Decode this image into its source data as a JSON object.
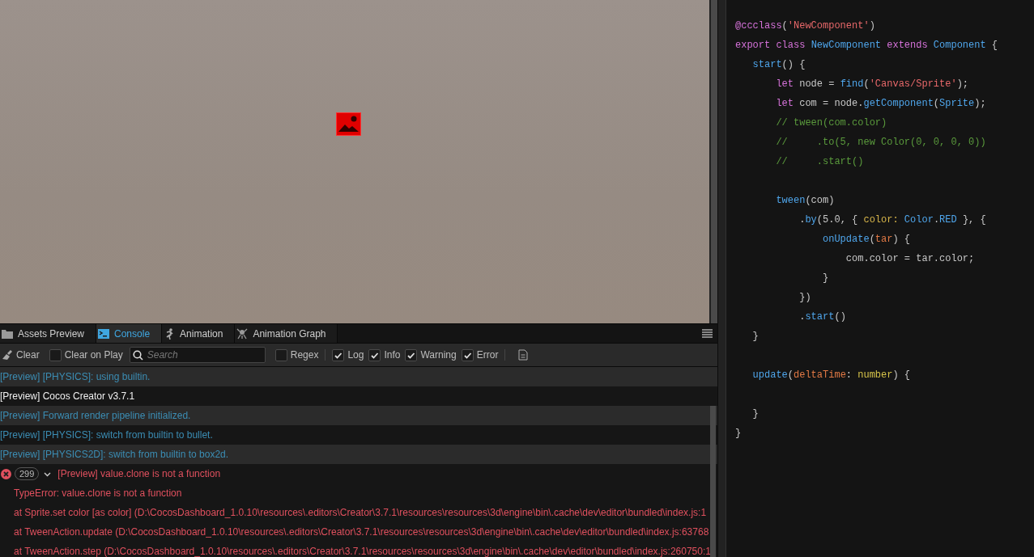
{
  "tabs": [
    {
      "label": "Assets Preview",
      "kind": "folder",
      "selected": false
    },
    {
      "label": "Console",
      "kind": "terminal",
      "selected": true
    },
    {
      "label": "Animation",
      "kind": "runner",
      "selected": false
    },
    {
      "label": "Animation Graph",
      "kind": "graph",
      "selected": false
    }
  ],
  "toolbar": {
    "clear": "Clear",
    "clear_on_play": {
      "label": "Clear on Play",
      "checked": false
    },
    "search": {
      "placeholder": "Search"
    },
    "regex": {
      "label": "Regex",
      "checked": false
    },
    "filters": [
      {
        "label": "Log",
        "checked": true
      },
      {
        "label": "Info",
        "checked": true
      },
      {
        "label": "Warning",
        "checked": true
      },
      {
        "label": "Error",
        "checked": true
      }
    ]
  },
  "log": [
    {
      "kind": "info",
      "text": "[Preview] [PHYSICS]: using builtin."
    },
    {
      "kind": "log",
      "text": "[Preview] Cocos Creator v3.7.1"
    },
    {
      "kind": "info",
      "text": "[Preview] Forward render pipeline initialized."
    },
    {
      "kind": "info",
      "text": "[Preview] [PHYSICS]: switch from builtin to bullet."
    },
    {
      "kind": "info",
      "text": "[Preview] [PHYSICS2D]: switch from builtin to box2d."
    },
    {
      "kind": "error",
      "count": "299",
      "expanded": true,
      "text": "[Preview] value.clone is not a function",
      "stack": [
        "TypeError: value.clone is not a function",
        "at Sprite.set color [as color] (D:\\CocosDashboard_1.0.10\\resources\\.editors\\Creator\\3.7.1\\resources\\resources\\3d\\engine\\bin\\.cache\\dev\\editor\\bundled\\index.js:1",
        "at TweenAction.update (D:\\CocosDashboard_1.0.10\\resources\\.editors\\Creator\\3.7.1\\resources\\resources\\3d\\engine\\bin\\.cache\\dev\\editor\\bundled\\index.js:63768",
        "at TweenAction.step (D:\\CocosDashboard_1.0.10\\resources\\.editors\\Creator\\3.7.1\\resources\\resources\\3d\\engine\\bin\\.cache\\dev\\editor\\bundled\\index.js:260750:1"
      ]
    }
  ],
  "code": [
    {
      "kind": "code",
      "tokens": [
        {
          "kind": "keyword",
          "text": "@ccclass"
        },
        {
          "kind": "plain",
          "text": "("
        },
        {
          "kind": "string",
          "text": "'NewComponent'"
        },
        {
          "kind": "plain",
          "text": ")"
        }
      ]
    },
    {
      "kind": "code",
      "tokens": [
        {
          "kind": "keyword",
          "text": "export class "
        },
        {
          "kind": "name",
          "text": "NewComponent"
        },
        {
          "kind": "keyword",
          "text": " extends "
        },
        {
          "kind": "name",
          "text": "Component"
        },
        {
          "kind": "plain",
          "text": " {"
        }
      ]
    },
    {
      "kind": "code",
      "tokens": [
        {
          "kind": "name",
          "text": "   start"
        },
        {
          "kind": "plain",
          "text": "() {"
        }
      ]
    },
    {
      "kind": "code",
      "tokens": [
        {
          "kind": "keyword",
          "text": "       let"
        },
        {
          "kind": "plain",
          "text": " node = "
        },
        {
          "kind": "name",
          "text": "find"
        },
        {
          "kind": "plain",
          "text": "("
        },
        {
          "kind": "string",
          "text": "'Canvas/Sprite'"
        },
        {
          "kind": "plain",
          "text": ");"
        }
      ]
    },
    {
      "kind": "code",
      "tokens": [
        {
          "kind": "keyword",
          "text": "       let"
        },
        {
          "kind": "plain",
          "text": " com = node."
        },
        {
          "kind": "name",
          "text": "getComponent"
        },
        {
          "kind": "plain",
          "text": "("
        },
        {
          "kind": "name",
          "text": "Sprite"
        },
        {
          "kind": "plain",
          "text": ");"
        }
      ]
    },
    {
      "kind": "code",
      "tokens": [
        {
          "kind": "comment",
          "text": "       // tween(com.color)"
        }
      ]
    },
    {
      "kind": "code",
      "tokens": [
        {
          "kind": "comment",
          "text": "       //     .to(5, new Color(0, 0, 0, 0))"
        }
      ]
    },
    {
      "kind": "code",
      "tokens": [
        {
          "kind": "comment",
          "text": "       //     .start()"
        }
      ]
    },
    {
      "kind": "blank"
    },
    {
      "kind": "code",
      "tokens": [
        {
          "kind": "name",
          "text": "       tween"
        },
        {
          "kind": "plain",
          "text": "(com)"
        }
      ]
    },
    {
      "kind": "code",
      "tokens": [
        {
          "kind": "plain",
          "text": "           ."
        },
        {
          "kind": "name",
          "text": "by"
        },
        {
          "kind": "plain",
          "text": "(5.0, { "
        },
        {
          "kind": "property",
          "text": "color:"
        },
        {
          "kind": "name",
          "text": " Color"
        },
        {
          "kind": "plain",
          "text": "."
        },
        {
          "kind": "name",
          "text": "RED"
        },
        {
          "kind": "plain",
          "text": " }, {"
        }
      ]
    },
    {
      "kind": "code",
      "tokens": [
        {
          "kind": "name",
          "text": "               onUpdate"
        },
        {
          "kind": "plain",
          "text": "("
        },
        {
          "kind": "param",
          "text": "tar"
        },
        {
          "kind": "plain",
          "text": ") {"
        }
      ]
    },
    {
      "kind": "code",
      "tokens": [
        {
          "kind": "plain",
          "text": "                   com.color = tar.color;"
        }
      ]
    },
    {
      "kind": "code",
      "tokens": [
        {
          "kind": "plain",
          "text": "               }"
        }
      ]
    },
    {
      "kind": "code",
      "tokens": [
        {
          "kind": "plain",
          "text": "           })"
        }
      ]
    },
    {
      "kind": "code",
      "tokens": [
        {
          "kind": "plain",
          "text": "           ."
        },
        {
          "kind": "name",
          "text": "start"
        },
        {
          "kind": "plain",
          "text": "()"
        }
      ]
    },
    {
      "kind": "code",
      "tokens": [
        {
          "kind": "plain",
          "text": "   }"
        }
      ]
    },
    {
      "kind": "blank"
    },
    {
      "kind": "code",
      "tokens": [
        {
          "kind": "name",
          "text": "   update"
        },
        {
          "kind": "plain",
          "text": "("
        },
        {
          "kind": "param",
          "text": "deltaTime"
        },
        {
          "kind": "plain",
          "text": ": "
        },
        {
          "kind": "type",
          "text": "number"
        },
        {
          "kind": "plain",
          "text": ") {"
        }
      ]
    },
    {
      "kind": "blank"
    },
    {
      "kind": "code",
      "tokens": [
        {
          "kind": "plain",
          "text": "   }"
        }
      ]
    },
    {
      "kind": "code",
      "tokens": [
        {
          "kind": "plain",
          "text": "}"
        }
      ]
    }
  ]
}
